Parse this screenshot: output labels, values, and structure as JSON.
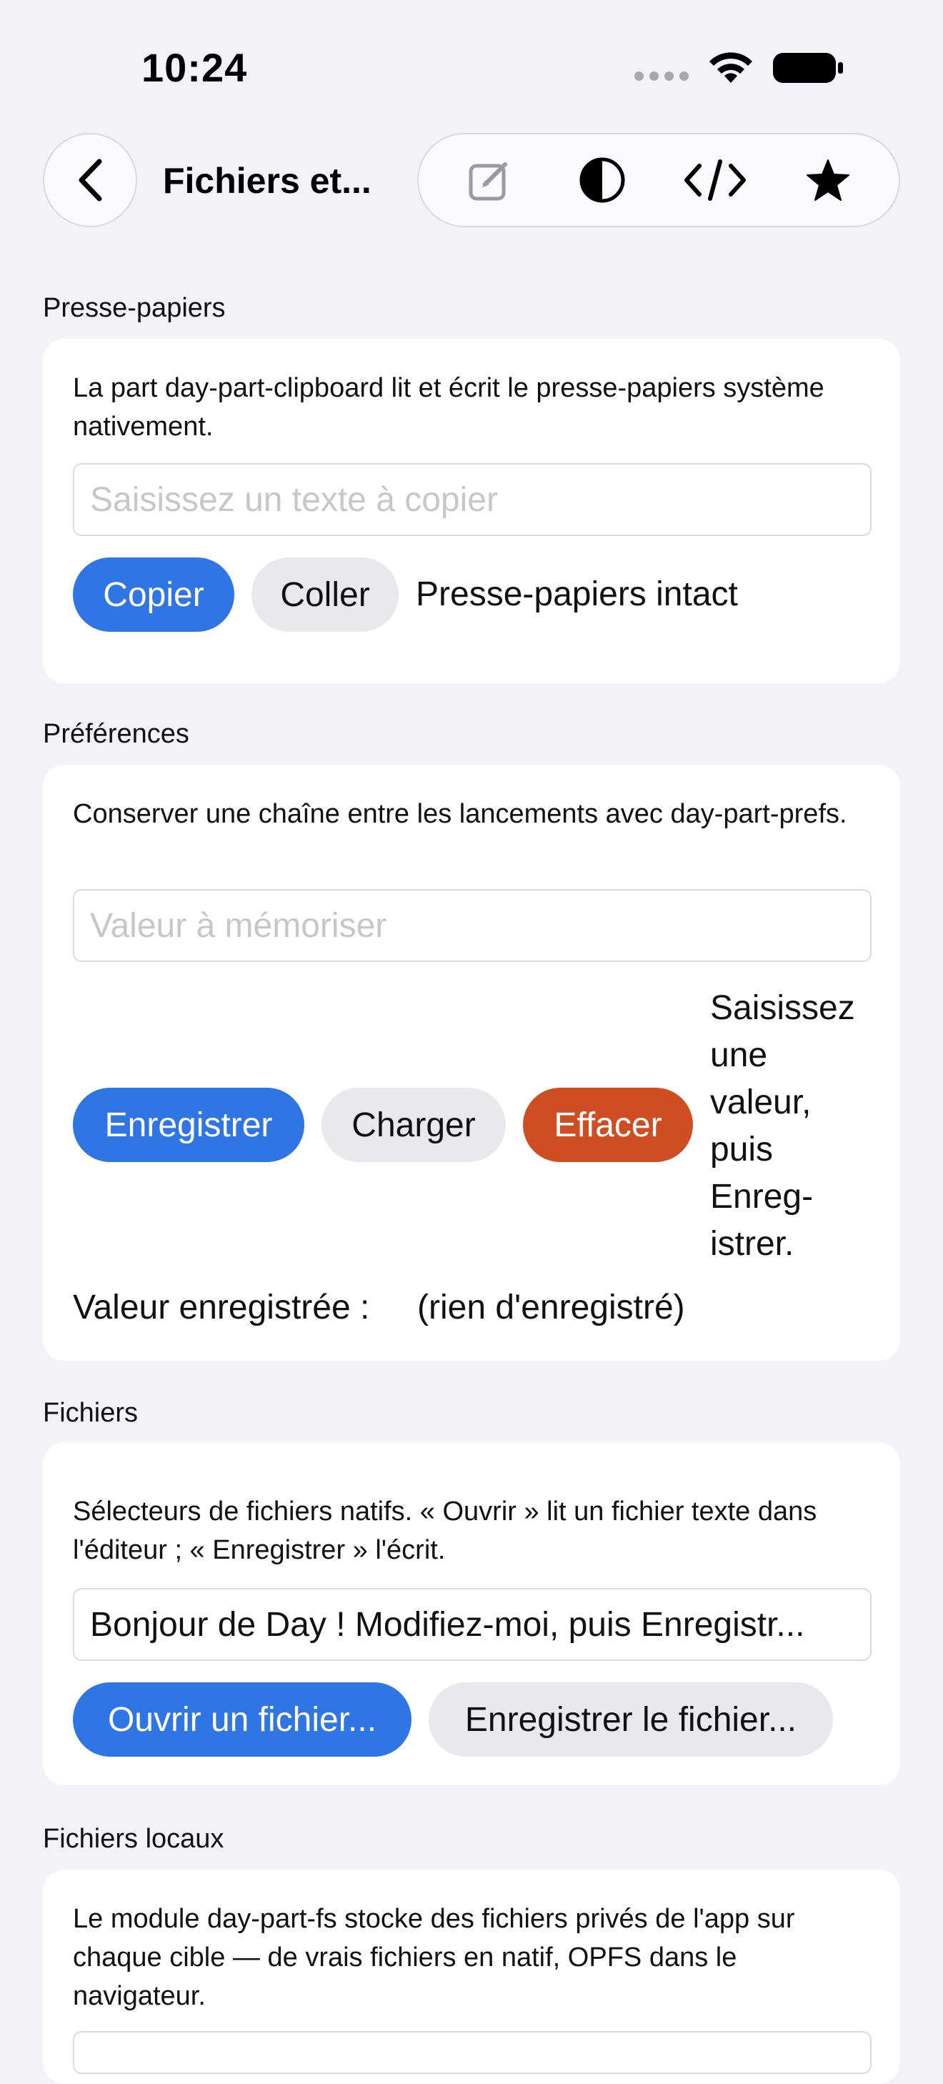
{
  "status": {
    "time": "10:24"
  },
  "nav": {
    "title": "Fichiers et..."
  },
  "clipboard": {
    "section": "Presse-papiers",
    "description": "La part day-part-clipboard lit et écrit le presse-papiers système nativement.",
    "placeholder": "Saisissez un texte à copier",
    "copy_label": "Copier",
    "paste_label": "Coller",
    "status": "Presse-papiers intact"
  },
  "prefs": {
    "section": "Préférences",
    "description": "Conserver une chaîne entre les lancements avec day-part-prefs.",
    "placeholder": "Valeur à mémoriser",
    "save_label": "Enregistrer",
    "load_label": "Charger",
    "clear_label": "Effacer",
    "status_lines": [
      "Saisissez",
      "une",
      "valeur,",
      "puis",
      "Enreg-",
      "istrer."
    ],
    "saved_label": "Valeur enregistrée :",
    "saved_value": "(rien d'enregistré)"
  },
  "files": {
    "section": "Fichiers",
    "description": "Sélecteurs de fichiers natifs. « Ouvrir » lit un fichier texte dans l'éditeur ; « Enregistrer » l'écrit.",
    "editor_value": "Bonjour de Day ! Modifiez-moi, puis Enregistr...",
    "open_label": "Ouvrir un fichier...",
    "save_label": "Enregistrer le fichier..."
  },
  "local_files": {
    "section": "Fichiers locaux",
    "description": "Le module day-part-fs stocke des fichiers privés de l'app sur chaque cible — de vrais fichiers en natif, OPFS dans le navigateur."
  },
  "colors": {
    "accent": "#2f76e4",
    "danger": "#cf4d22",
    "background": "#f2f2f7"
  }
}
